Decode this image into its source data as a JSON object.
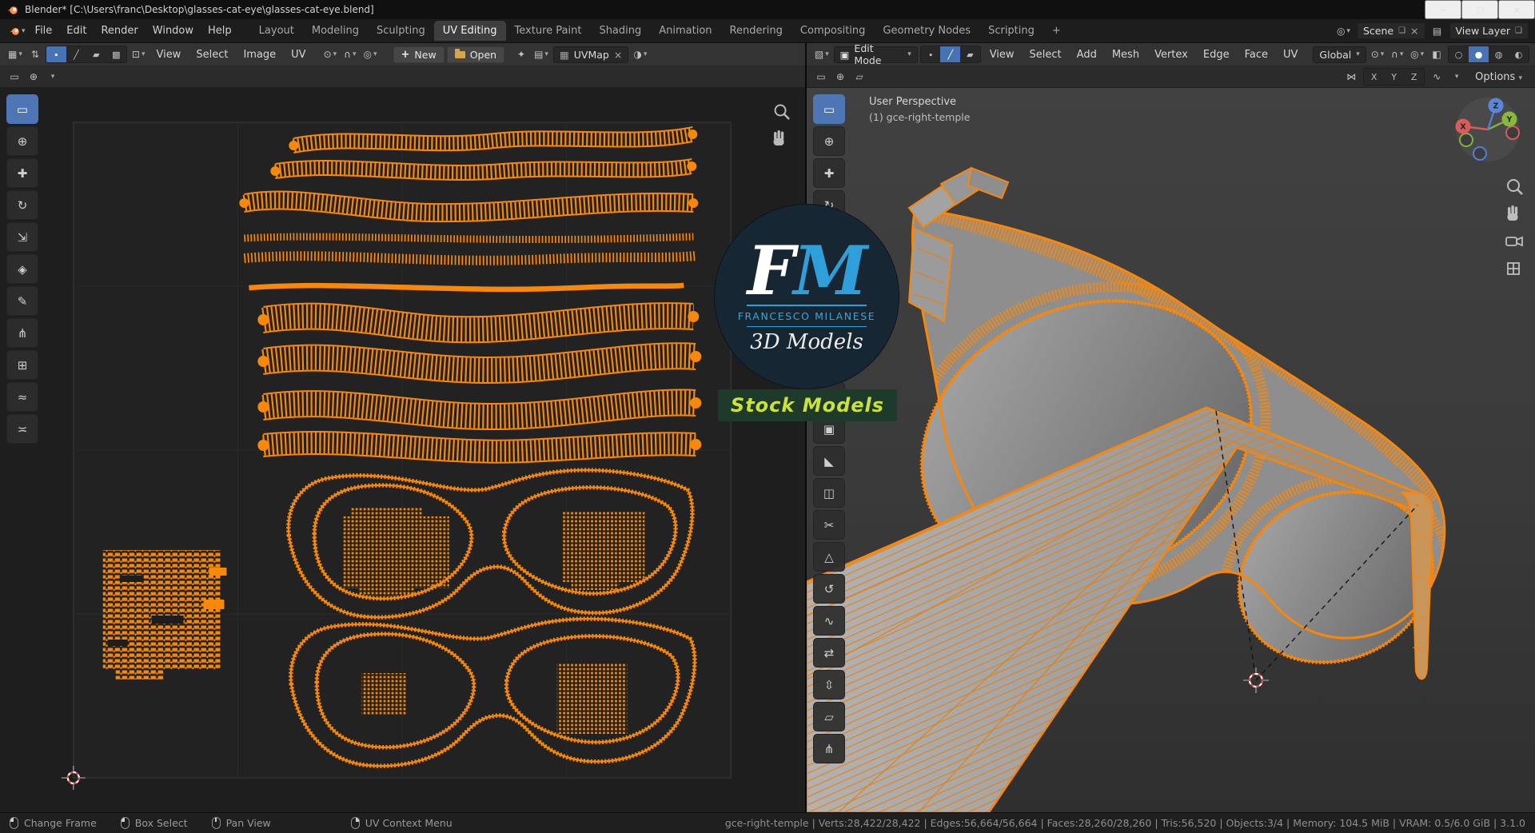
{
  "window": {
    "title": "Blender* [C:\\Users\\franc\\Desktop\\glasses-cat-eye\\glasses-cat-eye.blend]",
    "minimize": "−",
    "maximize": "□",
    "close": "×"
  },
  "topbar": {
    "menus": [
      "File",
      "Edit",
      "Render",
      "Window",
      "Help"
    ],
    "workspaces": [
      "Layout",
      "Modeling",
      "Sculpting",
      "UV Editing",
      "Texture Paint",
      "Shading",
      "Animation",
      "Rendering",
      "Compositing",
      "Geometry Nodes",
      "Scripting"
    ],
    "add_tab": "+",
    "scene_label": "Scene",
    "view_layer_label": "View Layer"
  },
  "uv_editor": {
    "menus": [
      "View",
      "Select",
      "Image",
      "UV"
    ],
    "new_label": "New",
    "open_label": "Open",
    "uvmap": "UVMap",
    "tools": [
      {
        "name": "select-box",
        "glyph": "▭"
      },
      {
        "name": "cursor",
        "glyph": "⊕"
      },
      {
        "name": "move",
        "glyph": "✚"
      },
      {
        "name": "rotate",
        "glyph": "↻"
      },
      {
        "name": "scale",
        "glyph": "⇲"
      },
      {
        "name": "transform",
        "glyph": "◈"
      },
      {
        "name": "annotate",
        "glyph": "✎"
      },
      {
        "name": "rip-region",
        "glyph": "⋔"
      },
      {
        "name": "grab",
        "glyph": "⊞"
      },
      {
        "name": "relax",
        "glyph": "≈"
      },
      {
        "name": "pinch",
        "glyph": "≍"
      }
    ]
  },
  "viewport": {
    "mode": "Edit Mode",
    "menus": [
      "View",
      "Select",
      "Add",
      "Mesh",
      "Vertex",
      "Edge",
      "Face",
      "UV"
    ],
    "orientation": "Global",
    "mirror": [
      "X",
      "Y",
      "Z"
    ],
    "options_label": "Options",
    "overlay_perspective": "User Perspective",
    "overlay_object": "(1) gce-right-temple",
    "gizmo": [
      "X",
      "Y",
      "Z"
    ],
    "tools": [
      {
        "name": "select-box",
        "glyph": "▭"
      },
      {
        "name": "cursor",
        "glyph": "⊕"
      },
      {
        "name": "move",
        "glyph": "✚"
      },
      {
        "name": "rotate",
        "glyph": "↻"
      },
      {
        "name": "scale",
        "glyph": "⇲"
      },
      {
        "name": "transform",
        "glyph": "◈"
      },
      {
        "name": "annotate",
        "glyph": "✎"
      },
      {
        "name": "measure",
        "glyph": "⊿"
      },
      {
        "name": "add-cube",
        "glyph": "▦"
      },
      {
        "name": "extrude",
        "glyph": "⇧"
      },
      {
        "name": "inset",
        "glyph": "▣"
      },
      {
        "name": "bevel",
        "glyph": "◣"
      },
      {
        "name": "loop-cut",
        "glyph": "◫"
      },
      {
        "name": "knife",
        "glyph": "✂"
      },
      {
        "name": "poly-build",
        "glyph": "△"
      },
      {
        "name": "spin",
        "glyph": "↺"
      },
      {
        "name": "smooth",
        "glyph": "∿"
      },
      {
        "name": "edge-slide",
        "glyph": "⇄"
      },
      {
        "name": "shrink-flatten",
        "glyph": "⇳"
      },
      {
        "name": "shear",
        "glyph": "▱"
      },
      {
        "name": "rip-region",
        "glyph": "⋔"
      }
    ]
  },
  "watermark": {
    "f": "F",
    "m": "M",
    "name": "FRANCESCO MILANESE",
    "subtitle": "3D Models",
    "banner": "Stock Models"
  },
  "statusbar": {
    "hints": [
      "Change Frame",
      "Box Select",
      "Pan View",
      "UV Context Menu"
    ],
    "stats": "gce-right-temple | Verts:28,422/28,422 | Edges:56,664/56,664 | Faces:28,260/28,260 | Tris:56,520 | Objects:3/4 | Memory: 104.5 MiB | VRAM: 0.5/6.0 GiB | 3.1.0"
  },
  "icons": {
    "caret": "▾",
    "sync": "⇅",
    "vertex": "∙",
    "edge": "╱",
    "face": "▰",
    "island": "▩",
    "pivot": "⊙",
    "magnet": "∩",
    "proportional": "◎",
    "sticky": "⊡",
    "plus": "+",
    "pin": "✦",
    "browse": "▤",
    "close": "×",
    "copy": "❏",
    "display": "◑",
    "uvgrid": "▦",
    "editor_uv": "▦",
    "editor_3d": "▧",
    "editmode": "▣",
    "wire": "○",
    "solid": "●",
    "material": "◍",
    "rendered": "◐",
    "xray": "◧",
    "grid": "▦",
    "mirror_icon": "⋈",
    "snapwave": "∿",
    "scene": "◎",
    "view_layer": "▤",
    "ts_a": "▭",
    "ts_b": "⊕",
    "ts_c": "▱"
  },
  "colors": {
    "accent_orange": "#f8880a",
    "select_blue": "#4772b3"
  }
}
